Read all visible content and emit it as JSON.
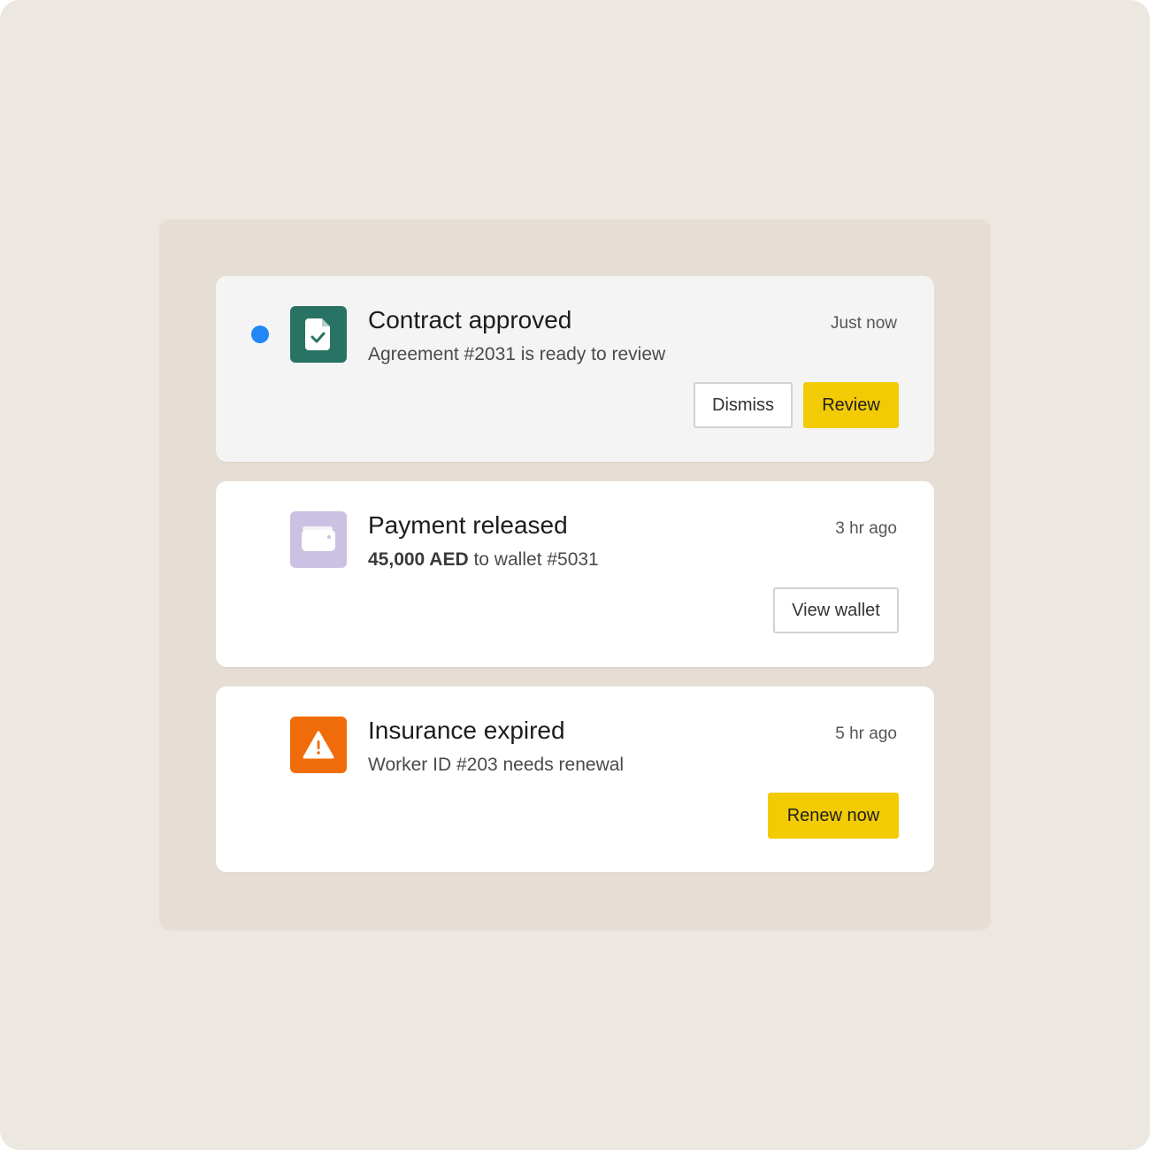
{
  "colors": {
    "page_background": "#ece7e1",
    "panel_background": "#e6ded5",
    "unread_dot": "#2187f5",
    "primary_button": "#f2cb05",
    "contract_icon": "#287363",
    "payment_icon": "#cbc1e2",
    "insurance_icon": "#f06c0a"
  },
  "notifications": [
    {
      "unread": true,
      "icon": "document-check-icon",
      "title": "Contract approved",
      "description": "Agreement #2031 is ready to review",
      "time": "Just now",
      "actions": {
        "secondary": "Dismiss",
        "primary": "Review"
      }
    },
    {
      "unread": false,
      "icon": "wallet-icon",
      "title": "Payment released",
      "description_amount": "45,000 AED",
      "description_rest": " to wallet #5031",
      "time": "3 hr ago",
      "actions": {
        "secondary": "View wallet"
      }
    },
    {
      "unread": false,
      "icon": "warning-icon",
      "title": "Insurance expired",
      "description": "Worker ID #203 needs renewal",
      "time": "5 hr ago",
      "actions": {
        "primary": "Renew now"
      }
    }
  ]
}
